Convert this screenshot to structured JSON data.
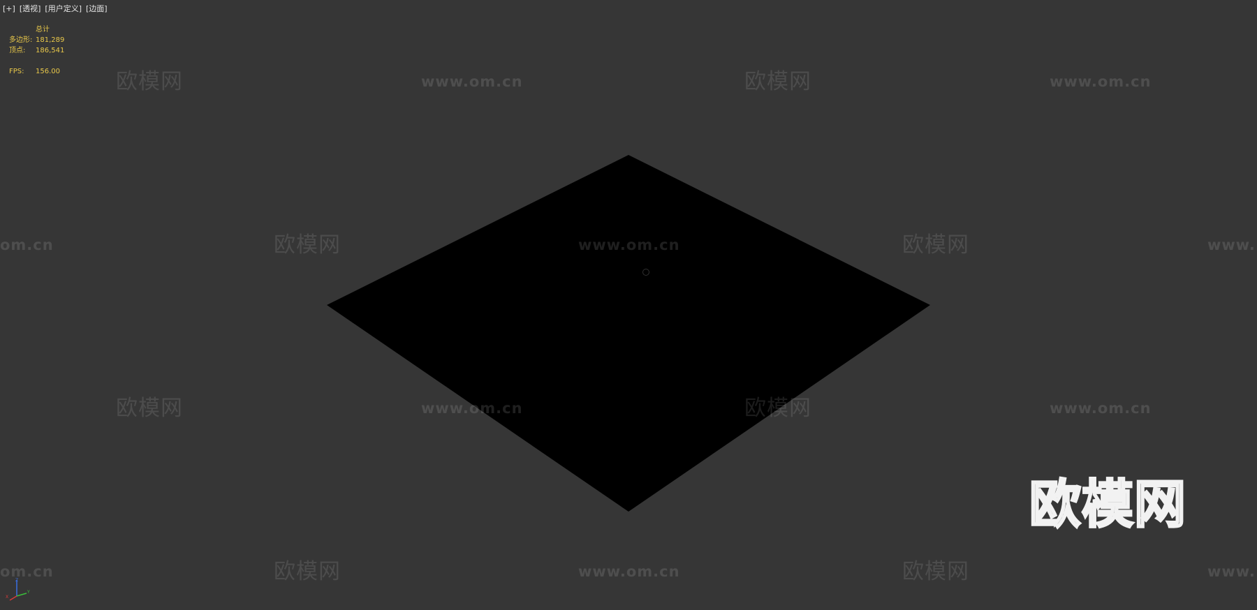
{
  "viewport": {
    "menu": [
      "[+]",
      "[透视]",
      "[用户定义]",
      "[边面]"
    ]
  },
  "stats": {
    "header": "总计",
    "polygons_label": "多边形:",
    "polygons_value": "181,289",
    "vertices_label": "顶点:",
    "vertices_value": "186,541",
    "fps_label": "FPS:",
    "fps_value": "156.00"
  },
  "watermarks": {
    "brand": "欧模网",
    "url": "www.om.cn",
    "url_partial_left": "om.cn",
    "url_partial_right": "www."
  },
  "gizmo": {
    "x": "X",
    "y": "Y",
    "z": "Z"
  },
  "colors": {
    "background": "#363636",
    "plane": "#000000",
    "stats_text": "#e9c84a",
    "menu_text": "#e6e6e6",
    "axis_x": "#d83a3a",
    "axis_y": "#3bbf3b",
    "axis_z": "#3a6ee0"
  }
}
